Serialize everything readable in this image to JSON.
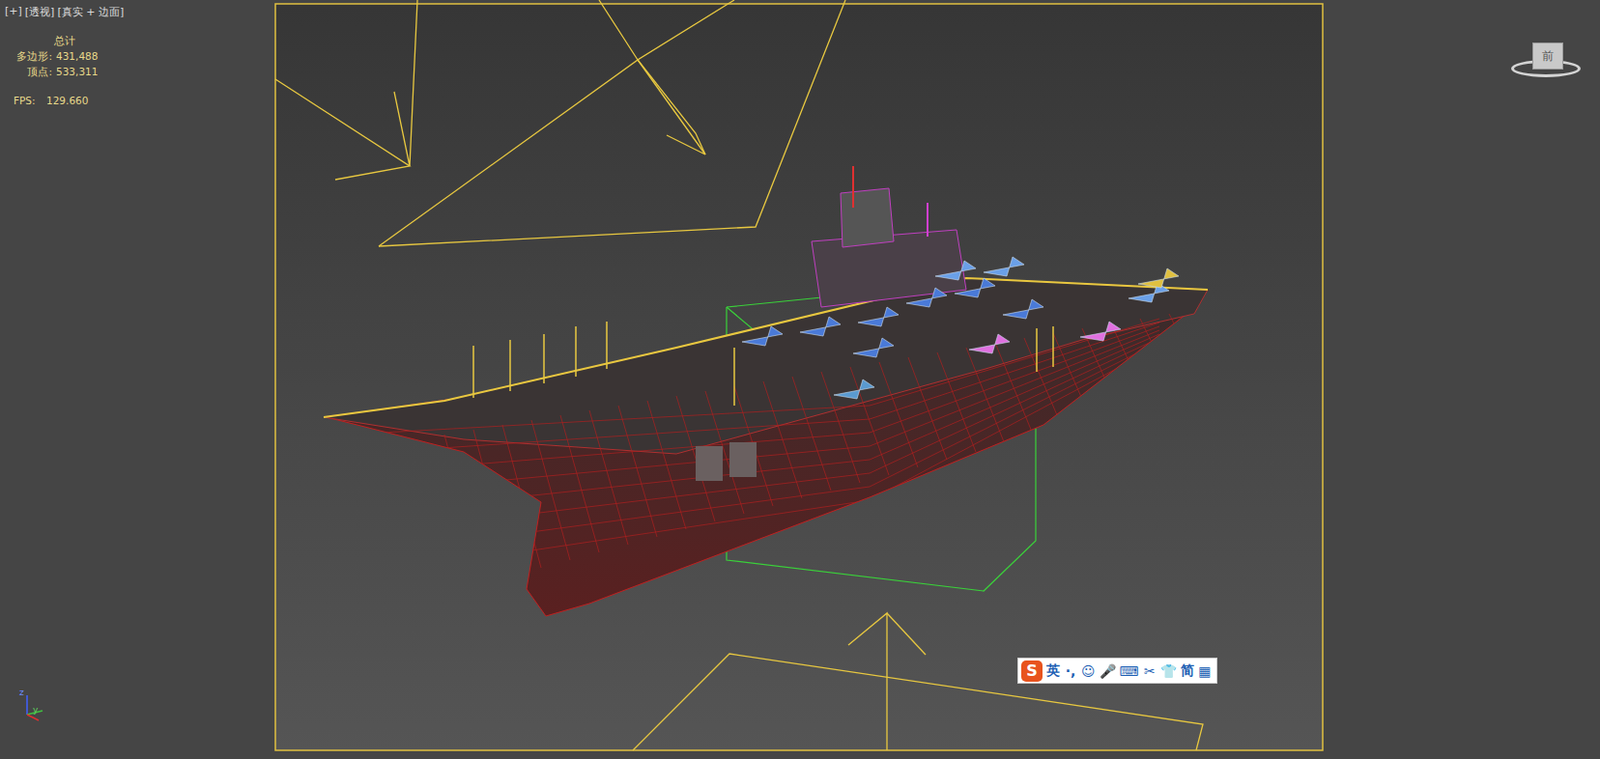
{
  "viewport": {
    "labels": [
      {
        "text": "[+]"
      },
      {
        "text": "[透视]"
      },
      {
        "text": "[真实 + 边面]"
      }
    ]
  },
  "stats": {
    "title": "总计",
    "rows": [
      {
        "label": "多边形:",
        "value": "431,488"
      },
      {
        "label": "顶点:",
        "value": "533,311"
      }
    ],
    "fps": {
      "label": "FPS:",
      "value": "129.660"
    }
  },
  "viewcube": {
    "label": "前"
  },
  "axis": {
    "z": "z",
    "y": "y"
  },
  "ime": {
    "logo": "S",
    "items": [
      "英",
      "·,",
      "☺",
      "🎤",
      "⌨",
      "✂",
      "👕",
      "简",
      "▦"
    ]
  }
}
